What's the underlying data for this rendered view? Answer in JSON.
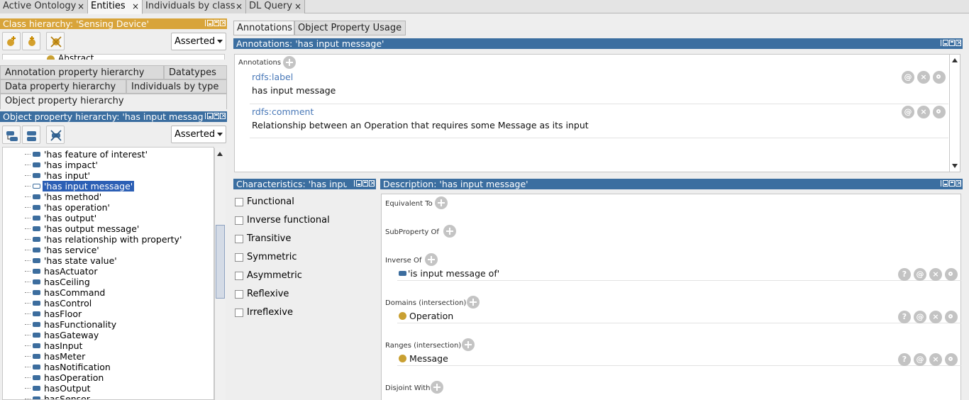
{
  "top_tabs": [
    {
      "label": "Active Ontology",
      "close": "×"
    },
    {
      "label": "Entities",
      "close": "×"
    },
    {
      "label": "Individuals by class",
      "close": "×"
    },
    {
      "label": "DL Query",
      "close": "×"
    }
  ],
  "class_hierarchy": {
    "title": "Class hierarchy: 'Sensing Device'",
    "mode": "Asserted",
    "partial_item": "Abstract"
  },
  "hierarchy_tabs": {
    "row1": [
      "Annotation property hierarchy",
      "Datatypes"
    ],
    "row2": [
      "Data property hierarchy",
      "Individuals by type"
    ],
    "row3": [
      "Object property hierarchy"
    ]
  },
  "object_property_hierarchy": {
    "title": "Object property hierarchy: 'has input message'",
    "mode": "Asserted",
    "items": [
      "'has feature of interest'",
      "'has impact'",
      "'has input'",
      "'has input message'",
      "'has method'",
      "'has operation'",
      "'has output'",
      "'has output message'",
      "'has relationship with property'",
      "'has service'",
      "'has state value'",
      "hasActuator",
      "hasCeiling",
      "hasCommand",
      "hasControl",
      "hasFloor",
      "hasFunctionality",
      "hasGateway",
      "hasInput",
      "hasMeter",
      "hasNotification",
      "hasOperation",
      "hasOutput",
      "hasSensor"
    ],
    "selected": "'has input message'"
  },
  "right_tabs": [
    "Annotations",
    "Object Property Usage"
  ],
  "annotations": {
    "title": "Annotations: 'has input message'",
    "header_label": "Annotations",
    "entries": [
      {
        "property": "rdfs:label",
        "value": "has input message"
      },
      {
        "property": "rdfs:comment",
        "value": "Relationship between an Operation that requires some Message as its input"
      }
    ],
    "btn_at": "@",
    "btn_x": "×"
  },
  "characteristics": {
    "title": "Characteristics: 'has input message'",
    "items": [
      "Functional",
      "Inverse functional",
      "Transitive",
      "Symmetric",
      "Asymmetric",
      "Reflexive",
      "Irreflexive"
    ]
  },
  "description": {
    "title": "Description: 'has input message'",
    "sections": {
      "equivalent": "Equivalent To",
      "subproperty": "SubProperty Of",
      "inverse": "Inverse Of",
      "domains": "Domains (intersection)",
      "ranges": "Ranges (intersection)",
      "disjoint": "Disjoint With"
    },
    "inverse_value": "'is input message of'",
    "domain_value": "Operation",
    "range_value": "Message",
    "btn_q": "?",
    "btn_at": "@",
    "btn_x": "×"
  },
  "colors": {
    "class_bar": "#d8a43a",
    "view_bar": "#3b6ea0",
    "selection": "#2c5fb5",
    "class_dot": "#c9a032",
    "property_icon": "#3c6d9e"
  }
}
